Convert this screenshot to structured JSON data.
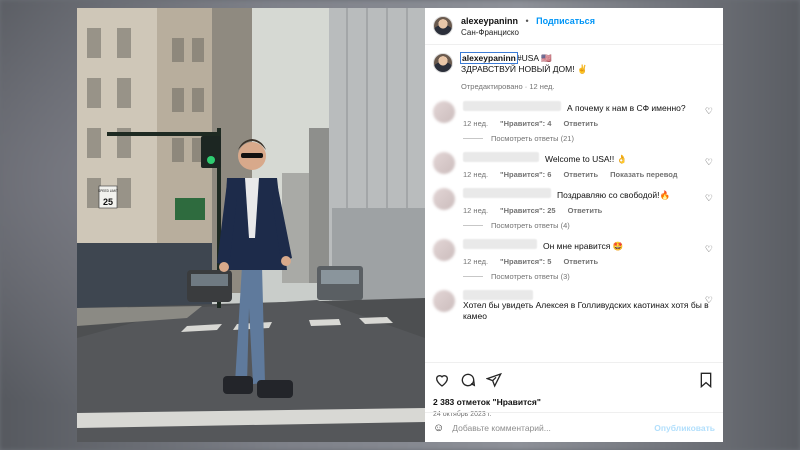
{
  "header": {
    "username": "alexeypaninn",
    "separator": "•",
    "follow_label": "Подписаться",
    "location": "Сан-Франциско"
  },
  "caption": {
    "username": "alexeypaninn",
    "text": "#USA 🇺🇸",
    "line2": "ЗДРАВСТВУЙ НОВЫЙ ДОМ! ✌️",
    "meta": "Отредактировано · 12 нед."
  },
  "comments": [
    {
      "text": "А почему к нам в СФ именно?",
      "age": "12 нед.",
      "likes": "\"Нравится\": 4",
      "reply": "Ответить",
      "extra": "",
      "replies": "Посмотреть ответы (21)"
    },
    {
      "text": "Welcome to USA!! 👌",
      "age": "12 нед.",
      "likes": "\"Нравится\": 6",
      "reply": "Ответить",
      "extra": "Показать перевод",
      "replies": ""
    },
    {
      "text": "Поздравляю со свободой!🔥",
      "age": "12 нед.",
      "likes": "\"Нравится\": 25",
      "reply": "Ответить",
      "extra": "",
      "replies": "Посмотреть ответы (4)"
    },
    {
      "text": "Он мне нравится 🤩",
      "age": "12 нед.",
      "likes": "\"Нравится\": 5",
      "reply": "Ответить",
      "extra": "",
      "replies": "Посмотреть ответы (3)"
    },
    {
      "text": "Хотел бы увидеть Алексея в Голливудских каотинах хотя бы в камео",
      "age": "",
      "likes": "",
      "reply": "",
      "extra": "",
      "replies": ""
    }
  ],
  "actions": {
    "like_icon": "heart-icon",
    "comment_icon": "comment-icon",
    "share_icon": "send-icon",
    "save_icon": "bookmark-icon",
    "likes_count": "2 383 отметок \"Нравится\"",
    "date": "24 октябрь 2023 г."
  },
  "add_comment": {
    "emoji_icon": "smiley-icon",
    "placeholder": "Добавьте комментарий...",
    "publish_label": "Опубликовать"
  },
  "photo": {
    "sign_speed_limit": "SPEED LIMIT",
    "sign_speed_value": "25"
  },
  "colors": {
    "accent": "#0095f6",
    "muted": "#737373",
    "publish_disabled": "#b2dffc"
  }
}
